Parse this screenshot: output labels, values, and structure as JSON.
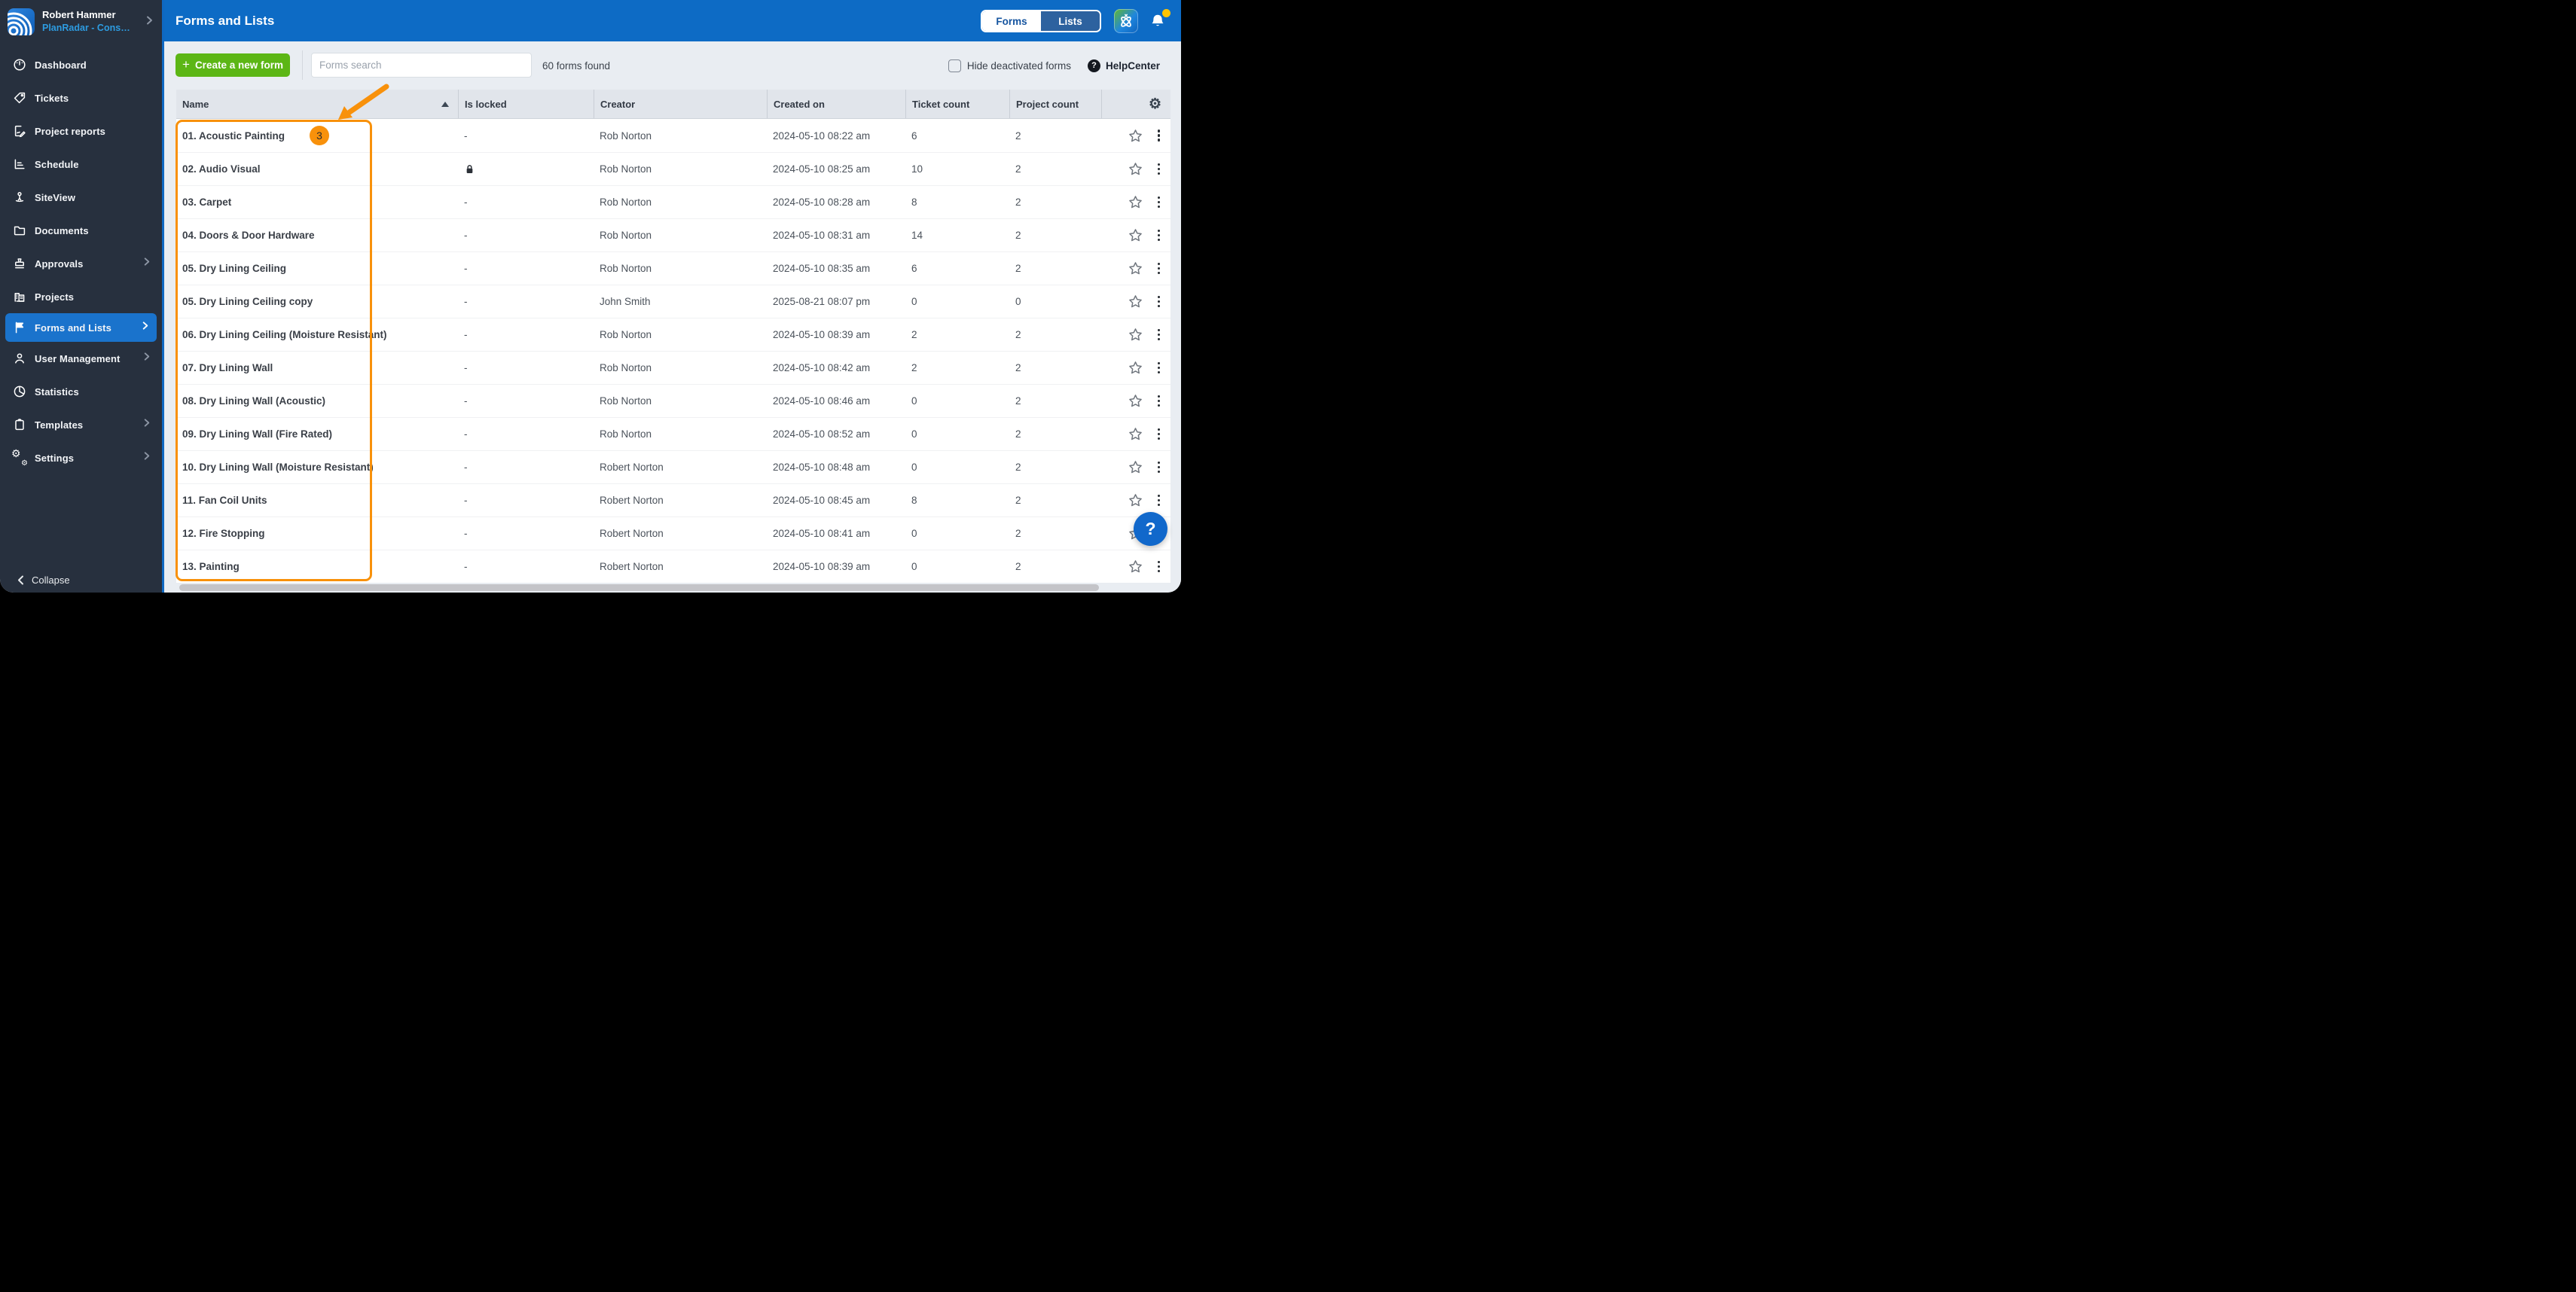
{
  "sidebar": {
    "user": {
      "name": "Robert Hammer",
      "account": "PlanRadar - Construc..."
    },
    "items": [
      {
        "label": "Dashboard",
        "icon": "dashboard-icon",
        "chevron": false,
        "active": false
      },
      {
        "label": "Tickets",
        "icon": "tickets-icon",
        "chevron": false,
        "active": false
      },
      {
        "label": "Project reports",
        "icon": "project-reports-icon",
        "chevron": false,
        "active": false
      },
      {
        "label": "Schedule",
        "icon": "schedule-icon",
        "chevron": false,
        "active": false
      },
      {
        "label": "SiteView",
        "icon": "siteview-icon",
        "chevron": false,
        "active": false
      },
      {
        "label": "Documents",
        "icon": "documents-icon",
        "chevron": false,
        "active": false
      },
      {
        "label": "Approvals",
        "icon": "approvals-icon",
        "chevron": true,
        "active": false
      },
      {
        "label": "Projects",
        "icon": "projects-icon",
        "chevron": false,
        "active": false
      },
      {
        "label": "Forms and Lists",
        "icon": "flag-icon",
        "chevron": true,
        "active": true
      },
      {
        "label": "User Management",
        "icon": "user-icon",
        "chevron": true,
        "active": false
      },
      {
        "label": "Statistics",
        "icon": "statistics-icon",
        "chevron": false,
        "active": false
      },
      {
        "label": "Templates",
        "icon": "templates-icon",
        "chevron": true,
        "active": false
      },
      {
        "label": "Settings",
        "icon": "settings-icon",
        "chevron": true,
        "active": false
      }
    ],
    "collapse_label": "Collapse"
  },
  "topbar": {
    "title": "Forms and Lists",
    "segmented": {
      "forms": "Forms",
      "lists": "Lists",
      "selected": "Forms"
    },
    "icons": [
      "connect-icon",
      "bell-icon"
    ],
    "bell_has_notification": true
  },
  "toolbar": {
    "create_label": "Create a new form",
    "search_placeholder": "Forms search",
    "search_value": "",
    "results_text": "60 forms found",
    "hide_deactivated_label": "Hide deactivated forms",
    "hide_deactivated_checked": false,
    "helpcenter_label": "HelpCenter"
  },
  "table": {
    "columns": [
      "Name",
      "Is locked",
      "Creator",
      "Created on",
      "Ticket count",
      "Project count"
    ],
    "sort": {
      "column": "Name",
      "direction": "asc"
    },
    "rows": [
      {
        "name": "01. Acoustic Painting",
        "badge": "3",
        "locked": false,
        "locked_display": "-",
        "creator": "Rob Norton",
        "created_on": "2024-05-10 08:22 am",
        "ticket_count": 6,
        "project_count": 2
      },
      {
        "name": "02. Audio Visual",
        "locked": true,
        "locked_display": "",
        "creator": "Rob Norton",
        "created_on": "2024-05-10 08:25 am",
        "ticket_count": 10,
        "project_count": 2
      },
      {
        "name": "03. Carpet",
        "locked": false,
        "locked_display": "-",
        "creator": "Rob Norton",
        "created_on": "2024-05-10 08:28 am",
        "ticket_count": 8,
        "project_count": 2
      },
      {
        "name": "04. Doors & Door Hardware",
        "locked": false,
        "locked_display": "-",
        "creator": "Rob Norton",
        "created_on": "2024-05-10 08:31 am",
        "ticket_count": 14,
        "project_count": 2
      },
      {
        "name": "05. Dry Lining Ceiling",
        "locked": false,
        "locked_display": "-",
        "creator": "Rob Norton",
        "created_on": "2024-05-10 08:35 am",
        "ticket_count": 6,
        "project_count": 2
      },
      {
        "name": "05. Dry Lining Ceiling copy",
        "locked": false,
        "locked_display": "-",
        "creator": "John Smith",
        "created_on": "2025-08-21 08:07 pm",
        "ticket_count": 0,
        "project_count": 0
      },
      {
        "name": "06. Dry Lining Ceiling (Moisture Resistant)",
        "locked": false,
        "locked_display": "-",
        "creator": "Rob Norton",
        "created_on": "2024-05-10 08:39 am",
        "ticket_count": 2,
        "project_count": 2
      },
      {
        "name": "07. Dry Lining Wall",
        "locked": false,
        "locked_display": "-",
        "creator": "Rob Norton",
        "created_on": "2024-05-10 08:42 am",
        "ticket_count": 2,
        "project_count": 2
      },
      {
        "name": "08. Dry Lining Wall (Acoustic)",
        "locked": false,
        "locked_display": "-",
        "creator": "Rob Norton",
        "created_on": "2024-05-10 08:46 am",
        "ticket_count": 0,
        "project_count": 2
      },
      {
        "name": "09. Dry Lining Wall (Fire Rated)",
        "locked": false,
        "locked_display": "-",
        "creator": "Rob Norton",
        "created_on": "2024-05-10 08:52 am",
        "ticket_count": 0,
        "project_count": 2
      },
      {
        "name": "10. Dry Lining Wall (Moisture Resistant)",
        "locked": false,
        "locked_display": "-",
        "creator": "Robert Norton",
        "created_on": "2024-05-10 08:48 am",
        "ticket_count": 0,
        "project_count": 2
      },
      {
        "name": "11. Fan Coil Units",
        "locked": false,
        "locked_display": "-",
        "creator": "Robert Norton",
        "created_on": "2024-05-10 08:45 am",
        "ticket_count": 8,
        "project_count": 2
      },
      {
        "name": "12. Fire Stopping",
        "locked": false,
        "locked_display": "-",
        "creator": "Robert Norton",
        "created_on": "2024-05-10 08:41 am",
        "ticket_count": 0,
        "project_count": 2
      },
      {
        "name": "13. Painting",
        "locked": false,
        "locked_display": "-",
        "creator": "Robert Norton",
        "created_on": "2024-05-10 08:39 am",
        "ticket_count": 0,
        "project_count": 2
      }
    ]
  },
  "floating_help": "?",
  "annotation": {
    "type": "highlight-box-with-arrow",
    "target": "name-column",
    "color": "#f8910b",
    "badge_on_first_row": "3"
  },
  "colors": {
    "topbar_blue": "#0d6bc5",
    "sidebar_dark": "#27303e",
    "active_item_blue": "#1a73cc",
    "create_green": "#5cb615",
    "annotation_orange": "#f8910b",
    "notification_yellow": "#ffc400",
    "help_fab_blue": "#1168cb",
    "page_background": "#e9edf2",
    "header_row_bg": "#e1e5eb"
  }
}
